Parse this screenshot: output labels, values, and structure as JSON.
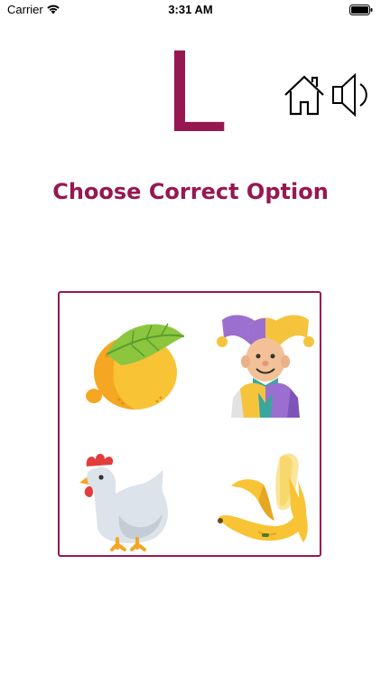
{
  "status_bar": {
    "carrier": "Carrier",
    "time": "3:31 AM"
  },
  "lesson": {
    "letter": "L",
    "prompt": "Choose Correct Option"
  },
  "toolbar": {
    "home_icon": "home-icon",
    "sound_icon": "speaker-icon"
  },
  "options": [
    {
      "name": "lemon",
      "icon": "lemon-icon"
    },
    {
      "name": "jester",
      "icon": "jester-icon"
    },
    {
      "name": "chicken",
      "icon": "chicken-icon"
    },
    {
      "name": "banana",
      "icon": "banana-icon"
    }
  ],
  "colors": {
    "accent": "#961852",
    "background": "#ffffff"
  }
}
